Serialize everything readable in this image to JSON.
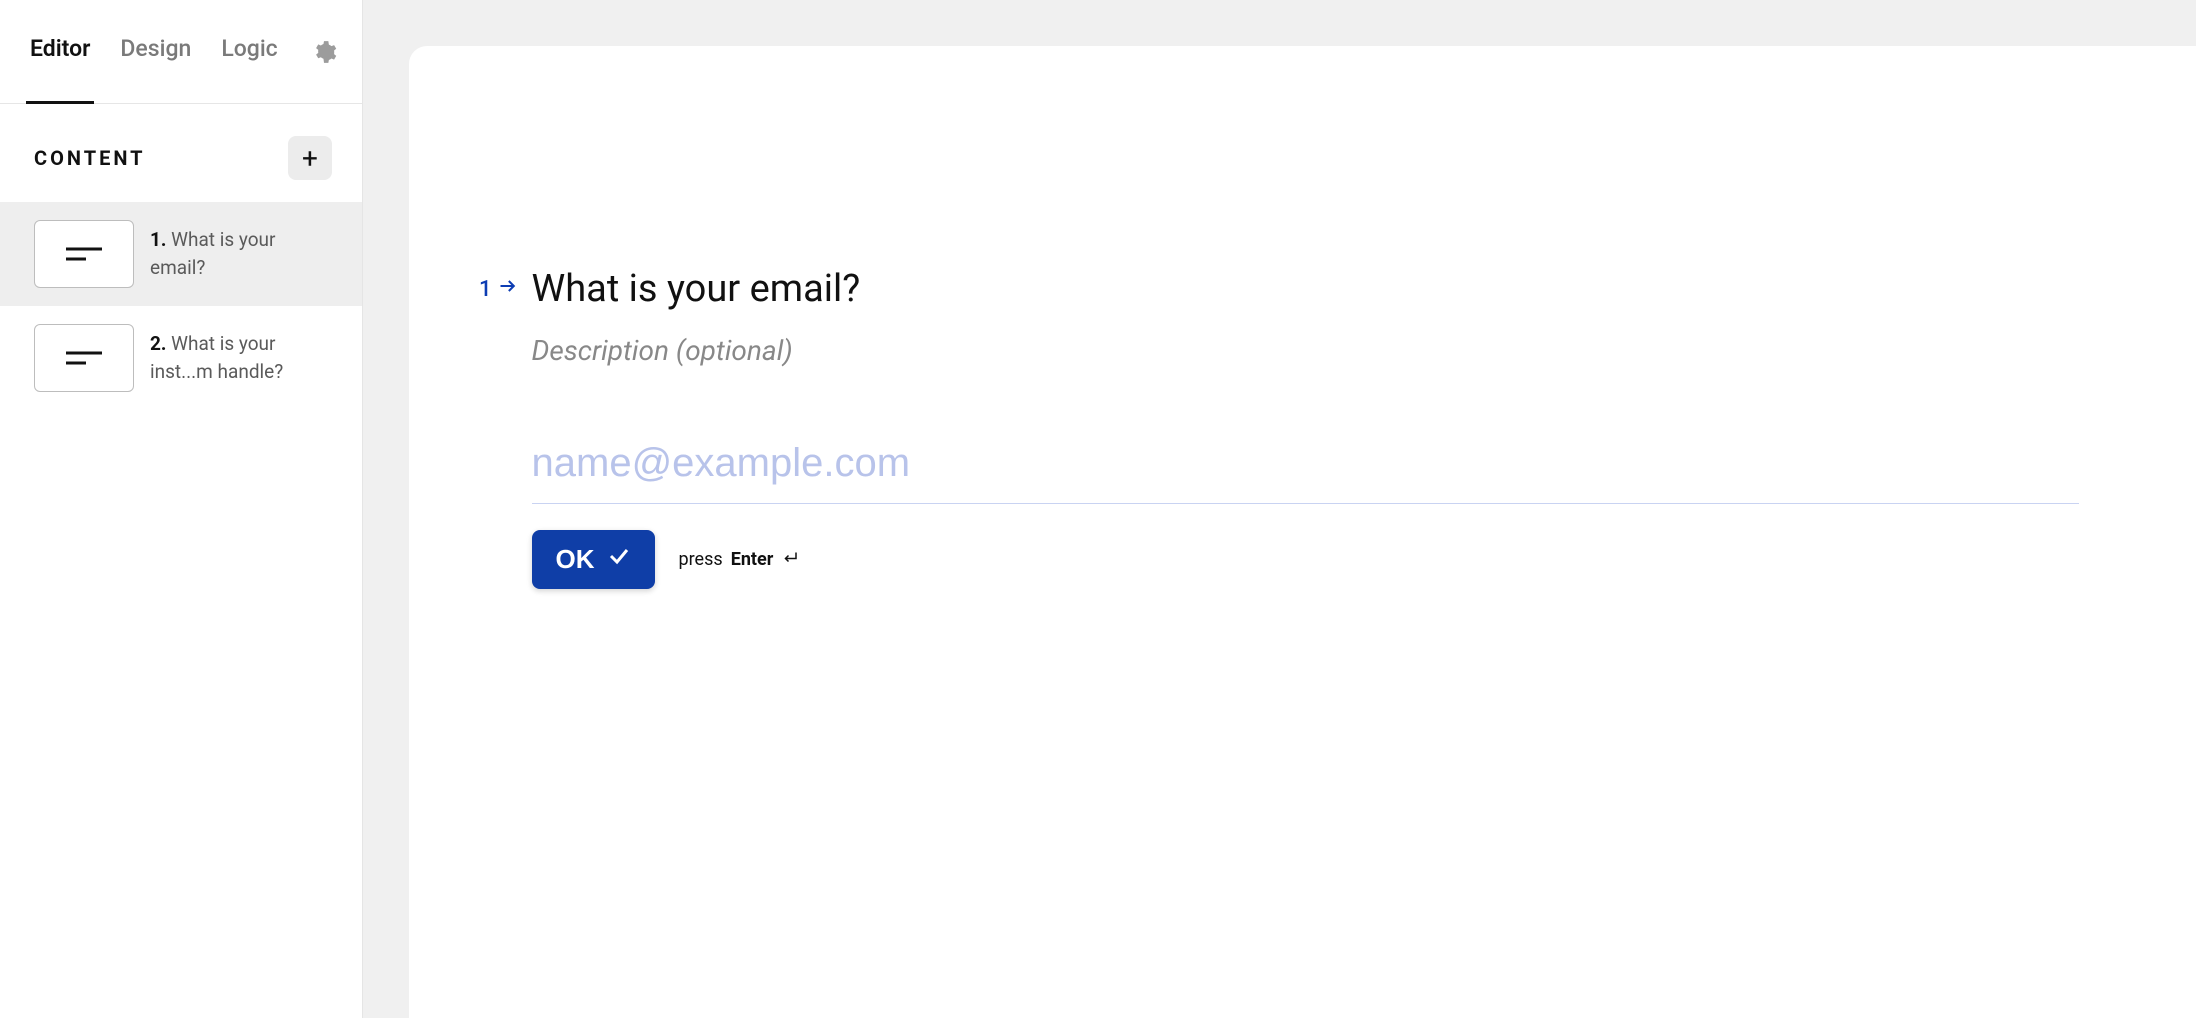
{
  "sidebar": {
    "tabs": [
      {
        "label": "Editor",
        "active": true
      },
      {
        "label": "Design",
        "active": false
      },
      {
        "label": "Logic",
        "active": false
      }
    ],
    "content_label": "CONTENT",
    "questions": [
      {
        "num": "1.",
        "label": "What is your email?",
        "selected": true
      },
      {
        "num": "2.",
        "label": "What is your inst...m handle?",
        "selected": false
      }
    ]
  },
  "editor": {
    "question_number": "1",
    "question_title": "What is your email?",
    "description_placeholder": "Description (optional)",
    "input_placeholder": "name@example.com",
    "ok_label": "OK",
    "hint_prefix": "press",
    "hint_key": "Enter"
  }
}
